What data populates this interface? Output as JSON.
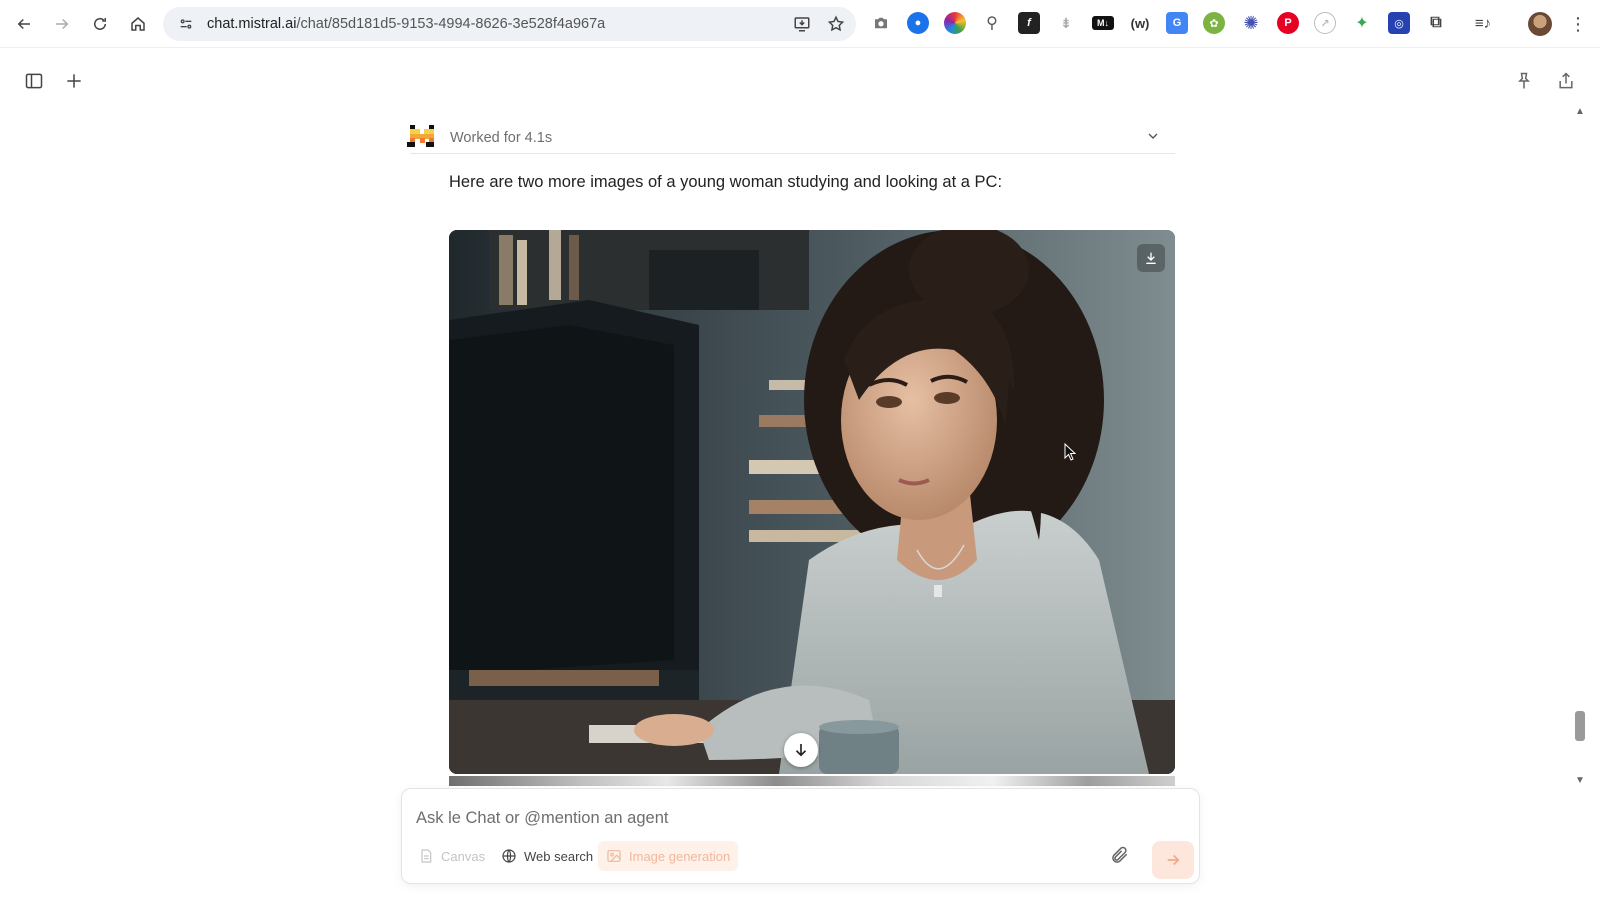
{
  "browser": {
    "url_host": "chat.mistral.ai",
    "url_path": "/chat/85d181d5-9153-4994-8626-3e528f4a967a"
  },
  "message": {
    "status": "Worked for 4.1s",
    "text": "Here are two more images of a young woman studying and looking at a PC:"
  },
  "composer": {
    "placeholder": "Ask le Chat or @mention an agent",
    "tools": {
      "canvas": "Canvas",
      "web_search": "Web search",
      "image_generation": "Image generation"
    }
  },
  "icons": {
    "brand": "mistral-logo-icon",
    "accent_color": "#f2a889"
  }
}
